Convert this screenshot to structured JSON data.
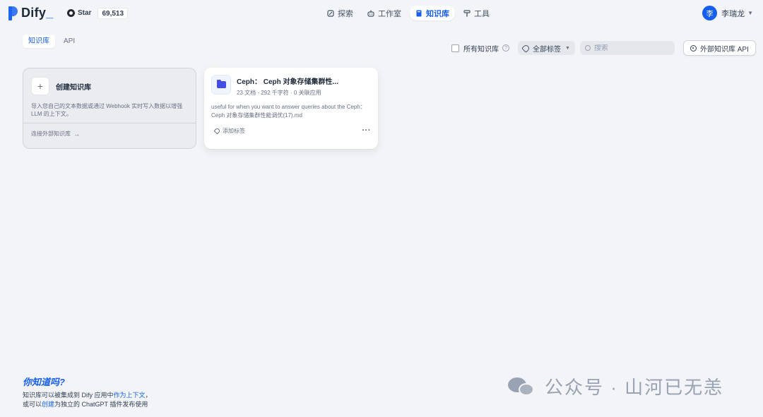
{
  "header": {
    "brand": "Dify",
    "brand_cursor": "_",
    "github": {
      "star_label": "Star",
      "star_count": "69,513"
    },
    "nav": [
      {
        "label": "探索",
        "icon": "explore-icon"
      },
      {
        "label": "工作室",
        "icon": "robot-icon"
      },
      {
        "label": "知识库",
        "icon": "book-icon",
        "active": true
      },
      {
        "label": "工具",
        "icon": "hammer-icon"
      }
    ],
    "user": {
      "avatar_initial": "李",
      "name": "李瑞龙"
    }
  },
  "tabs": [
    {
      "label": "知识库",
      "active": true
    },
    {
      "label": "API",
      "active": false
    }
  ],
  "filters": {
    "all_datasets_label": "所有知识库",
    "help_glyph": "?",
    "tag_filter_label": "全部标签",
    "search_placeholder": "搜索",
    "external_api_label": "外部知识库 API"
  },
  "create_card": {
    "plus": "+",
    "title": "创建知识库",
    "description": "导入您自己的文本数据或通过 Webhook 实时写入数据以增强 LLM 的上下文。",
    "link_label": "连接外部知识库",
    "arrow": "→"
  },
  "dataset_card": {
    "title": "Ceph： Ceph 对象存储集群性...",
    "meta": "23 文档 · 292 千字符 · 0 关联应用",
    "description": "useful for when you want to answer queries about the Ceph： Ceph 对象存储集群性能调优(17).md",
    "add_tag_label": "添加标签",
    "more": "···"
  },
  "tip": {
    "title": "你知道吗?",
    "line1_pre": "知识库可以被集成到 Dify 应用中",
    "line1_link": "作为上下文",
    "line1_post": "，",
    "line2_pre": "或可以",
    "line2_link": "创建",
    "line2_post": "为独立的 ChatGPT 插件发布使用"
  },
  "watermark": {
    "text": "公众号 · 山河已无恙"
  },
  "colors": {
    "accent": "#155eef",
    "background": "#f2f4f7",
    "folder": "#444ce7"
  }
}
